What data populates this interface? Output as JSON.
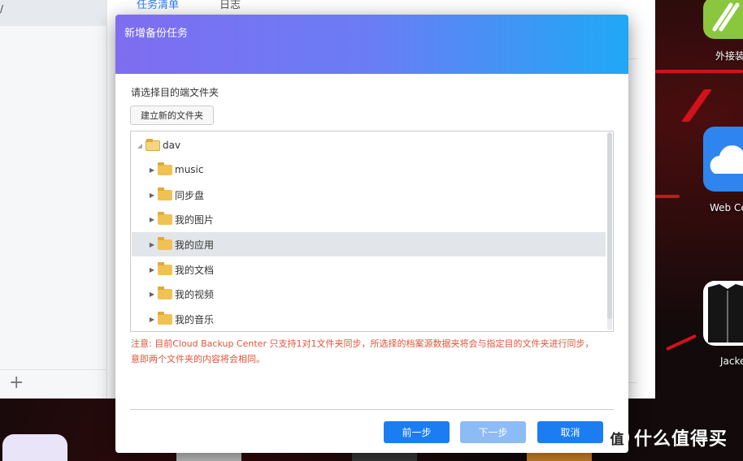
{
  "back_window": {
    "tabs": [
      {
        "label": "任务清单"
      },
      {
        "label": "日志"
      }
    ],
    "sidebar_selected_glyph": "/",
    "add_icon": "+"
  },
  "desktop_icons": [
    {
      "label": "外接装",
      "icon": "external-device-icon",
      "color": "#8bc63f"
    },
    {
      "label": "Web Ce",
      "icon": "web-center-icon",
      "color": "#2f85f0"
    },
    {
      "label": "Jacke",
      "icon": "jacket-app-icon",
      "color": "#1a1a1a"
    }
  ],
  "modal": {
    "title": "新增备份任务",
    "folder_prompt": "请选择目的端文件夹",
    "new_folder_button": "建立新的文件夹",
    "tree": {
      "root": "dav",
      "children": [
        {
          "label": "music",
          "selected": false
        },
        {
          "label": "同步盘",
          "selected": false
        },
        {
          "label": "我的图片",
          "selected": false
        },
        {
          "label": "我的应用",
          "selected": true
        },
        {
          "label": "我的文档",
          "selected": false
        },
        {
          "label": "我的视频",
          "selected": false
        },
        {
          "label": "我的音乐",
          "selected": false
        }
      ]
    },
    "note_line1": "注意: 目前Cloud Backup Center 只支持1对1文件夹同步，所选择的档案源数据夹将会与指定目的文件夹进行同步，",
    "note_line2": "意即两个文件夹的内容将会相同。",
    "buttons": {
      "prev": "前一步",
      "next": "下一步",
      "cancel": "取消"
    },
    "colors": {
      "header_start": "#7e6df0",
      "header_end": "#1fa8f5",
      "primary_button": "#1c7df3",
      "disabled_button": "#8dbbf5",
      "note_text": "#e2533b"
    }
  },
  "watermark": {
    "badge": "值",
    "text": "什么值得买"
  }
}
